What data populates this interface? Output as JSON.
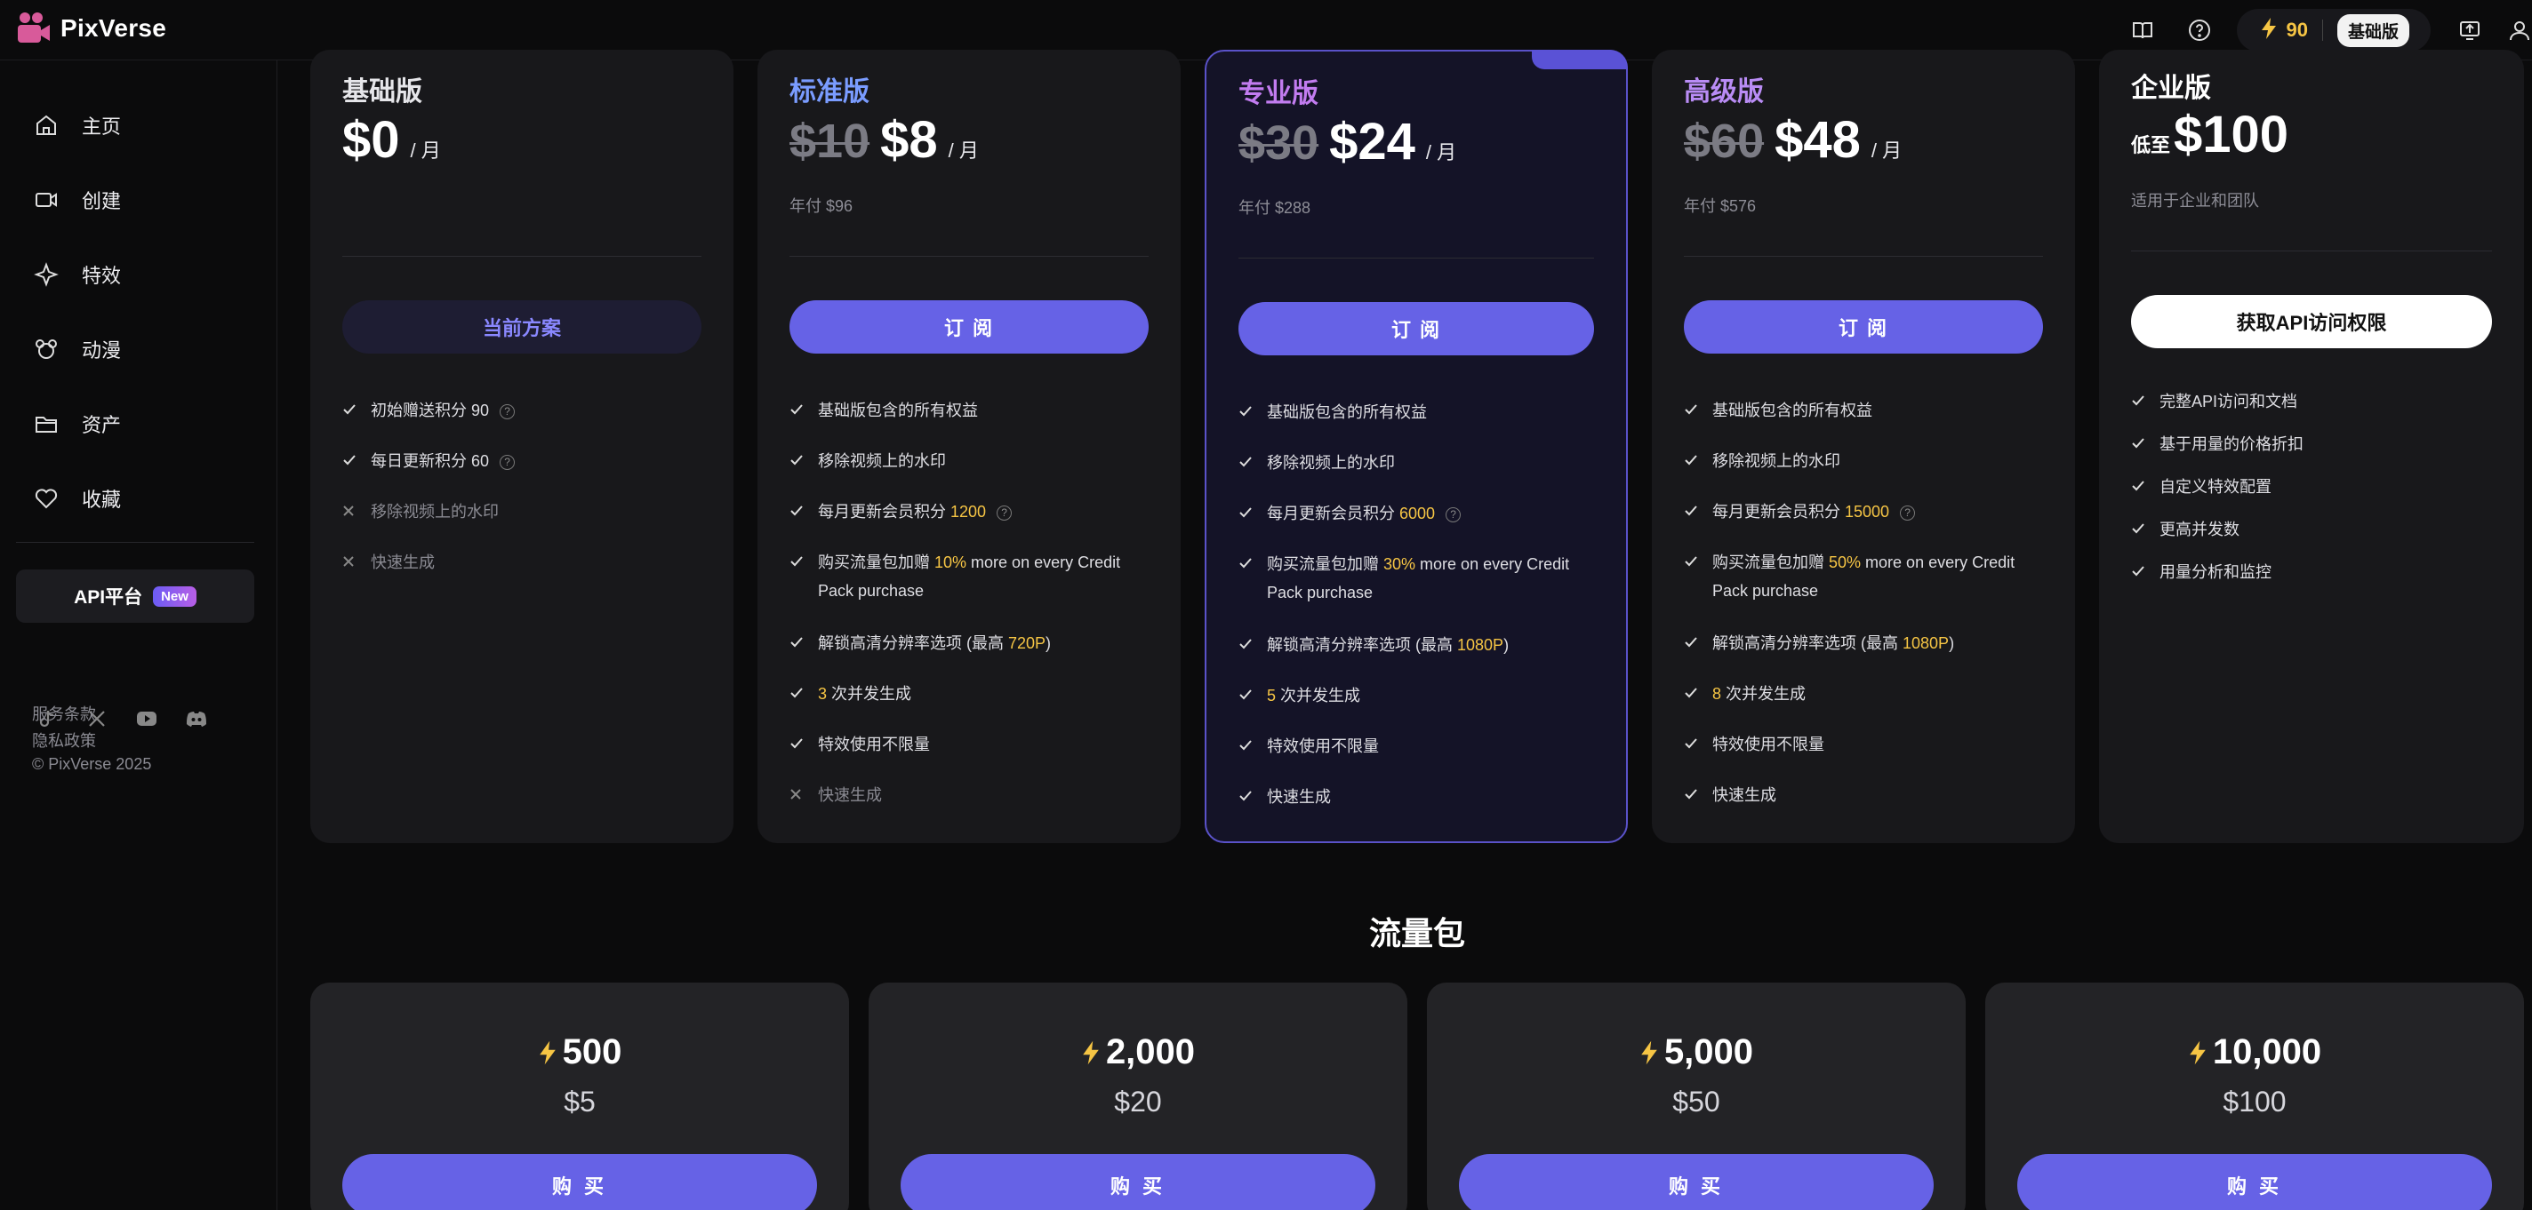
{
  "app": {
    "name": "PixVerse"
  },
  "topbar": {
    "credits": "90",
    "plan_badge": "基础版"
  },
  "sidebar": {
    "items": [
      {
        "label": "主页",
        "icon": "home-icon"
      },
      {
        "label": "创建",
        "icon": "video-camera-icon"
      },
      {
        "label": "特效",
        "icon": "sparkle-icon"
      },
      {
        "label": "动漫",
        "icon": "mouse-face-icon"
      },
      {
        "label": "资产",
        "icon": "folder-icon"
      },
      {
        "label": "收藏",
        "icon": "heart-icon"
      }
    ],
    "api_label": "API平台",
    "api_badge": "New",
    "footer": {
      "terms": "服务条款",
      "privacy": "隐私政策",
      "copyright": "© PixVerse 2025"
    }
  },
  "plans": {
    "basic": {
      "name": "基础版",
      "price": "$0",
      "per": "/ 月",
      "cta": "当前方案",
      "features": [
        {
          "text": "初始赠送积分 90"
        },
        {
          "text": "每日更新积分 60"
        },
        {
          "text": "移除视频上的水印"
        },
        {
          "text": "快速生成"
        }
      ]
    },
    "standard": {
      "name": "标准版",
      "old_price": "$10",
      "price": "$8",
      "per": "/ 月",
      "annual": "年付 $96",
      "cta": "订 阅",
      "features": [
        {
          "text": "基础版包含的所有权益"
        },
        {
          "text": "移除视频上的水印"
        },
        {
          "pre": "每月更新会员积分 ",
          "hl": "1200"
        },
        {
          "pre": "购买流量包加赠 ",
          "hl": "10%",
          "post": " more on every Credit Pack purchase"
        },
        {
          "pre": "解锁高清分辨率选项 (最高 ",
          "hl": "720P",
          "post": ")"
        },
        {
          "hl": "3",
          "post": " 次并发生成"
        },
        {
          "text": "特效使用不限量"
        },
        {
          "text": "快速生成"
        }
      ]
    },
    "pro": {
      "name": "专业版",
      "old_price": "$30",
      "price": "$24",
      "per": "/ 月",
      "annual": "年付 $288",
      "cta": "订 阅",
      "features": [
        {
          "text": "基础版包含的所有权益"
        },
        {
          "text": "移除视频上的水印"
        },
        {
          "pre": "每月更新会员积分 ",
          "hl": "6000"
        },
        {
          "pre": "购买流量包加赠 ",
          "hl": "30%",
          "post": " more on every Credit Pack purchase"
        },
        {
          "pre": "解锁高清分辨率选项 (最高 ",
          "hl": "1080P",
          "post": ")"
        },
        {
          "hl": "5",
          "post": " 次并发生成"
        },
        {
          "text": "特效使用不限量"
        },
        {
          "text": "快速生成"
        }
      ]
    },
    "premium": {
      "name": "高级版",
      "old_price": "$60",
      "price": "$48",
      "per": "/ 月",
      "annual": "年付 $576",
      "cta": "订 阅",
      "features": [
        {
          "text": "基础版包含的所有权益"
        },
        {
          "text": "移除视频上的水印"
        },
        {
          "pre": "每月更新会员积分 ",
          "hl": "15000"
        },
        {
          "pre": "购买流量包加赠 ",
          "hl": "50%",
          "post": " more on every Credit Pack purchase"
        },
        {
          "pre": "解锁高清分辨率选项 (最高 ",
          "hl": "1080P",
          "post": ")"
        },
        {
          "hl": "8",
          "post": " 次并发生成"
        },
        {
          "text": "特效使用不限量"
        },
        {
          "text": "快速生成"
        }
      ]
    },
    "enterprise": {
      "name": "企业版",
      "price_prefix": "低至",
      "price": "$100",
      "subtitle": "适用于企业和团队",
      "cta": "获取API访问权限",
      "features": [
        {
          "text": "完整API访问和文档"
        },
        {
          "text": "基于用量的价格折扣"
        },
        {
          "text": "自定义特效配置"
        },
        {
          "text": "更高并发数"
        },
        {
          "text": "用量分析和监控"
        }
      ]
    }
  },
  "packs": {
    "title": "流量包",
    "buy_label": "购 买",
    "items": [
      {
        "amount": "500",
        "price": "$5"
      },
      {
        "amount": "2,000",
        "price": "$20"
      },
      {
        "amount": "5,000",
        "price": "$50"
      },
      {
        "amount": "10,000",
        "price": "$100"
      }
    ]
  },
  "colors": {
    "accent": "#6662e6",
    "highlight": "#f6c544",
    "standard_title": "#7a9cff",
    "pro_title": "#c27cf0",
    "premium_title": "#b98cf5"
  }
}
